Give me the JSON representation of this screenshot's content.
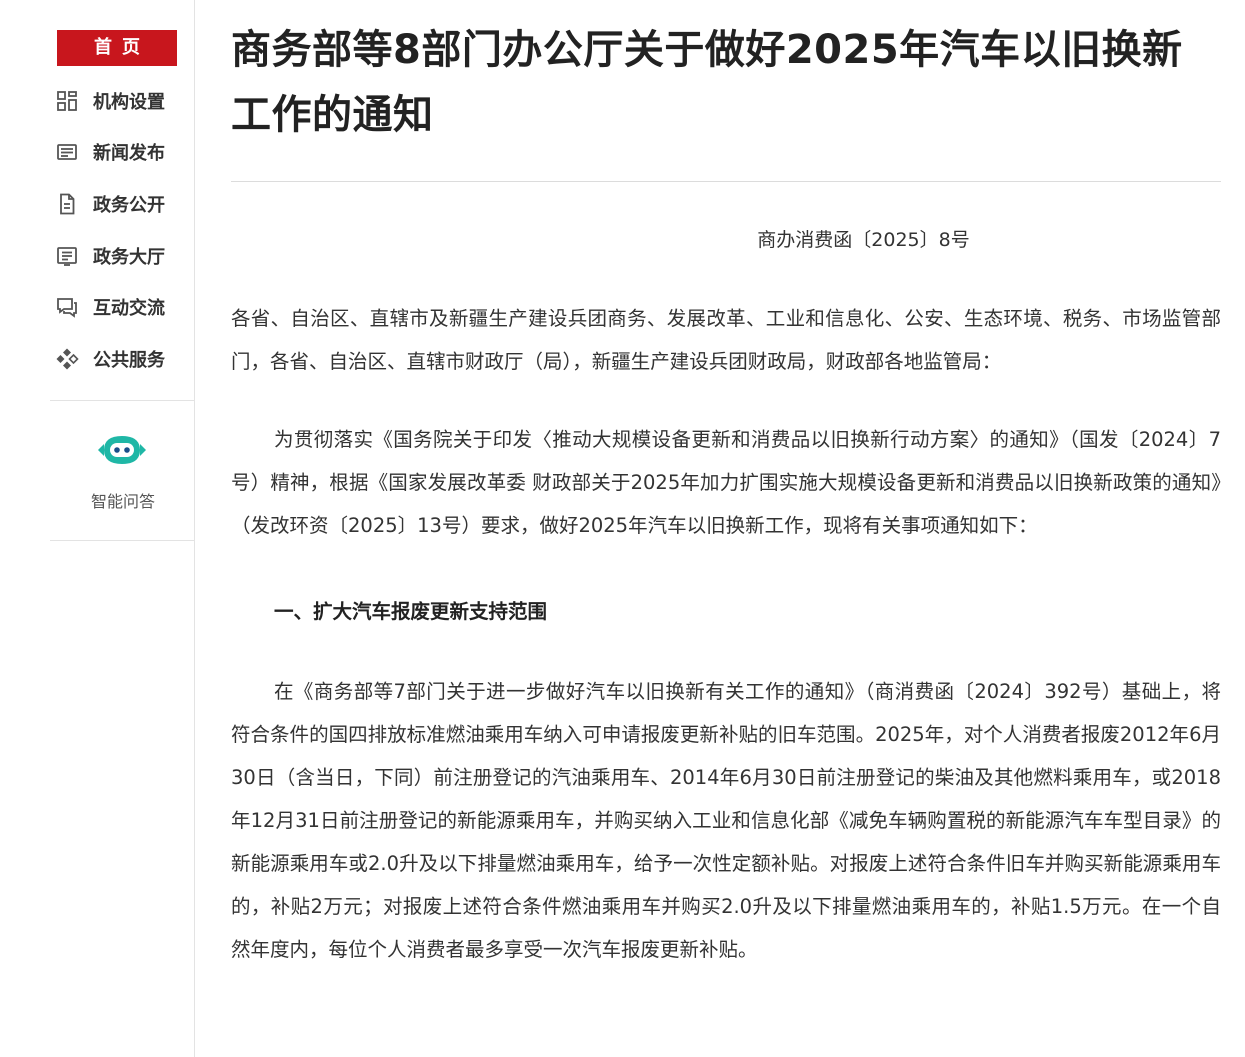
{
  "sidebar": {
    "home_label": "首页",
    "items": [
      {
        "label": "机构设置",
        "icon": "grid-icon"
      },
      {
        "label": "新闻发布",
        "icon": "news-icon"
      },
      {
        "label": "政务公开",
        "icon": "document-icon"
      },
      {
        "label": "政务大厅",
        "icon": "list-icon"
      },
      {
        "label": "互动交流",
        "icon": "chat-icon"
      },
      {
        "label": "公共服务",
        "icon": "service-icon"
      }
    ],
    "ai_assistant_label": "智能问答"
  },
  "article": {
    "title": "商务部等8部门办公厅关于做好2025年汽车以旧换新工作的通知",
    "doc_number": "商办消费函〔2025〕8号",
    "addressee": "各省、自治区、直辖市及新疆生产建设兵团商务、发展改革、工业和信息化、公安、生态环境、税务、市场监管部门，各省、自治区、直辖市财政厅（局），新疆生产建设兵团财政局，财政部各地监管局：",
    "intro": "为贯彻落实《国务院关于印发〈推动大规模设备更新和消费品以旧换新行动方案〉的通知》（国发〔2024〕7号）精神，根据《国家发展改革委 财政部关于2025年加力扩围实施大规模设备更新和消费品以旧换新政策的通知》（发改环资〔2025〕13号）要求，做好2025年汽车以旧换新工作，现将有关事项通知如下：",
    "section1_heading": "一、扩大汽车报废更新支持范围",
    "section1_body": "在《商务部等7部门关于进一步做好汽车以旧换新有关工作的通知》（商消费函〔2024〕392号）基础上，将符合条件的国四排放标准燃油乘用车纳入可申请报废更新补贴的旧车范围。2025年，对个人消费者报废2012年6月30日（含当日，下同）前注册登记的汽油乘用车、2014年6月30日前注册登记的柴油及其他燃料乘用车，或2018年12月31日前注册登记的新能源乘用车，并购买纳入工业和信息化部《减免车辆购置税的新能源汽车车型目录》的新能源乘用车或2.0升及以下排量燃油乘用车，给予一次性定额补贴。对报废上述符合条件旧车并购买新能源乘用车的，补贴2万元；对报废上述符合条件燃油乘用车并购买2.0升及以下排量燃油乘用车的，补贴1.5万元。在一个自然年度内，每位个人消费者最多享受一次汽车报废更新补贴。"
  },
  "colors": {
    "brand_red": "#c8161d",
    "ai_teal": "#1fb7a6"
  }
}
